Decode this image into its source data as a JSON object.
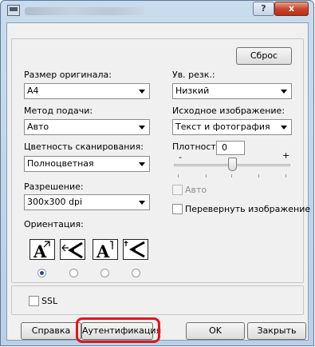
{
  "titlebar": {
    "help_label": "?",
    "close_label": "x"
  },
  "reset_label": "Сброс",
  "original_size": {
    "label": "Размер оригинала:",
    "value": "A4"
  },
  "feed_method": {
    "label": "Метод подачи:",
    "value": "Авто"
  },
  "scan_color": {
    "label": "Цветность сканирования:",
    "value": "Полноцветная"
  },
  "resolution": {
    "label": "Разрешение:",
    "value": "300x300 dpi"
  },
  "sharpness": {
    "label": "Ув. резк.:",
    "value": "Низкий"
  },
  "original_image": {
    "label": "Исходное изображение:",
    "value": "Текст и фотография"
  },
  "density": {
    "label": "Плотность:",
    "value": "0",
    "minus": "-",
    "plus": "+",
    "level": 0.5
  },
  "auto_label": "Авто",
  "flip_label": "Перевернуть изображение",
  "orientation": {
    "label": "Ориентация:",
    "selected_index": 0
  },
  "ssl_label": "SSL",
  "buttons": {
    "help": "Справка",
    "auth": "Аутентификация",
    "ok": "OK",
    "close": "Закрыть"
  }
}
